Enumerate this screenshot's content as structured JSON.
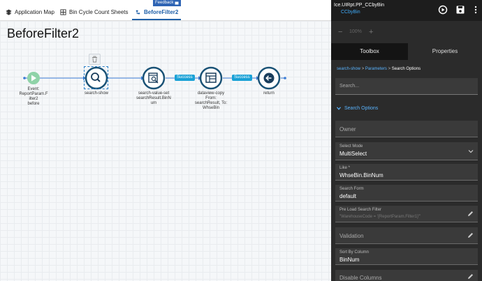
{
  "tabs": [
    {
      "label": "Application Map"
    },
    {
      "label": "Bin Cycle Count Sheets"
    },
    {
      "label": "BeforeFilter2"
    }
  ],
  "feedback": "Feedback",
  "page_title": "BeforeFilter2",
  "flow": {
    "start_label": "Event: ReportParam.F ilter2 before",
    "start_l1": "Event:",
    "start_l2": "ReportParam.F",
    "start_l3": "ilter2",
    "start_l4": "before",
    "n1": "search-show",
    "n2_l1": "search-value-set",
    "n2_l2": "searchResult.BinN",
    "n2_l3": "um",
    "n3_l1": "dataview-copy",
    "n3_l2": "From:",
    "n3_l3": "searchResult, To:",
    "n3_l4": "WhseBin",
    "n4": "return",
    "success1": "Success",
    "success2": "Success"
  },
  "panel": {
    "name": "Ice.UIRpt.PP_CCbyBin",
    "sub": "CCbyBin",
    "zoom": "100%",
    "zoom_minus": "−",
    "zoom_plus": "+",
    "tab_toolbox": "Toolbox",
    "tab_properties": "Properties",
    "crumb_1": "search-show",
    "crumb_sep": ">",
    "crumb_2": "Parameters",
    "crumb_3": "Search Options",
    "search_placeholder": "Search...",
    "section": "Search Options",
    "owner": "Owner",
    "select_mode_label": "Select Mode",
    "select_mode_value": "MultiSelect",
    "like_label": "Like *",
    "like_value": "WhseBin.BinNum",
    "search_form_label": "Search Form",
    "search_form_value": "default",
    "preload_label": "Pre Load Search Filter",
    "preload_value": "\"WarehouseCode = '{ReportParam.Filter1}'\"",
    "validation": "Validation",
    "sort_label": "Sort By Column",
    "sort_value": "BinNum",
    "disable_columns": "Disable Columns"
  },
  "colors": {
    "accent": "#1e5fa8",
    "node_ring": "#1a5276",
    "start": "#8fd3a8",
    "success": "#19a1d6",
    "link": "#5ab4ff"
  }
}
